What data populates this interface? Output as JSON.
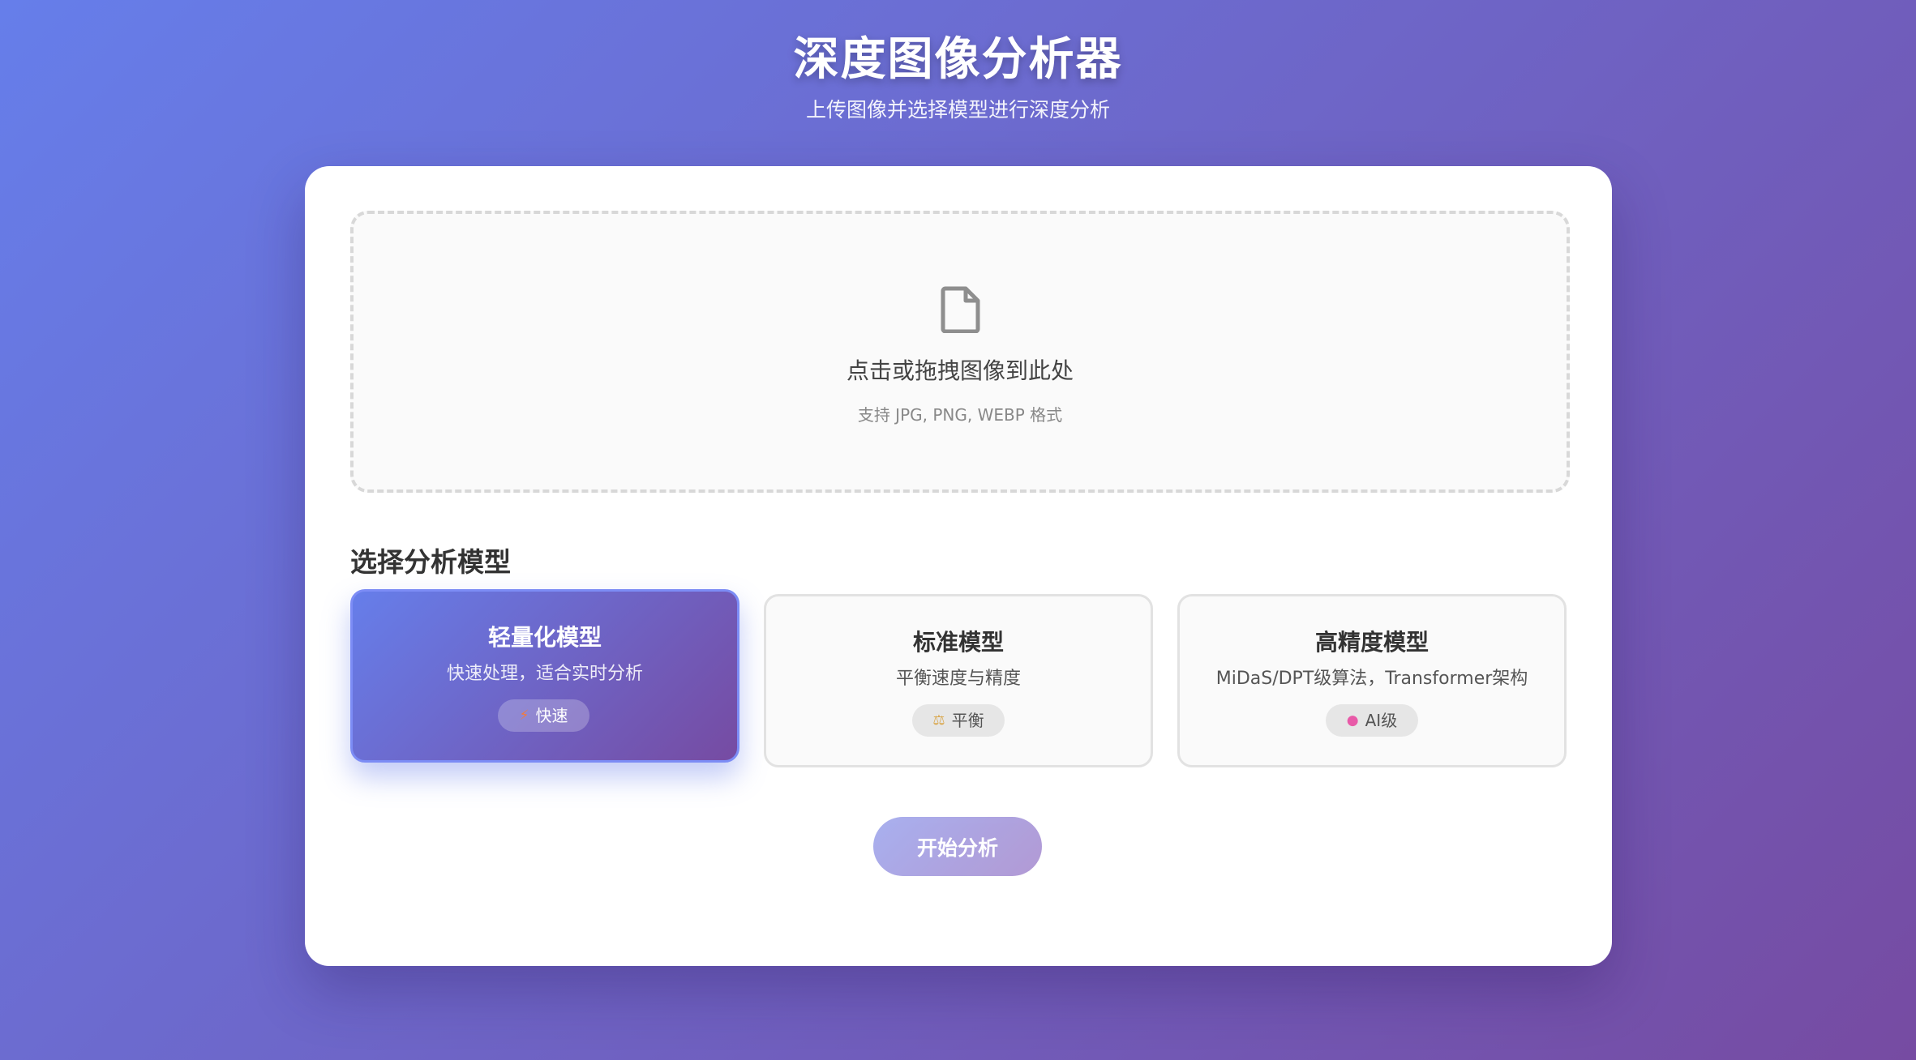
{
  "header": {
    "title": "深度图像分析器",
    "subtitle": "上传图像并选择模型进行深度分析"
  },
  "upload": {
    "icon": "file-icon",
    "title": "点击或拖拽图像到此处",
    "hint": "支持 JPG, PNG, WEBP 格式"
  },
  "models": {
    "section_title": "选择分析模型",
    "selected_index": 0,
    "items": [
      {
        "name": "轻量化模型",
        "description": "快速处理，适合实时分析",
        "badge_icon": "⚡",
        "badge_icon_name": "lightning-icon",
        "badge_label": "快速"
      },
      {
        "name": "标准模型",
        "description": "平衡速度与精度",
        "badge_icon": "⚖",
        "badge_icon_name": "balance-scale-icon",
        "badge_label": "平衡"
      },
      {
        "name": "高精度模型",
        "description": "MiDaS/DPT级算法，Transformer架构",
        "badge_icon": "●",
        "badge_icon_name": "brain-icon",
        "badge_label": "AI级"
      }
    ]
  },
  "actions": {
    "start_label": "开始分析"
  },
  "colors": {
    "gradient_start": "#667eea",
    "gradient_end": "#764ba2",
    "brain_icon": "#e85aa8",
    "balance_icon": "#d9a64a",
    "lightning_icon": "#f07b3f"
  }
}
